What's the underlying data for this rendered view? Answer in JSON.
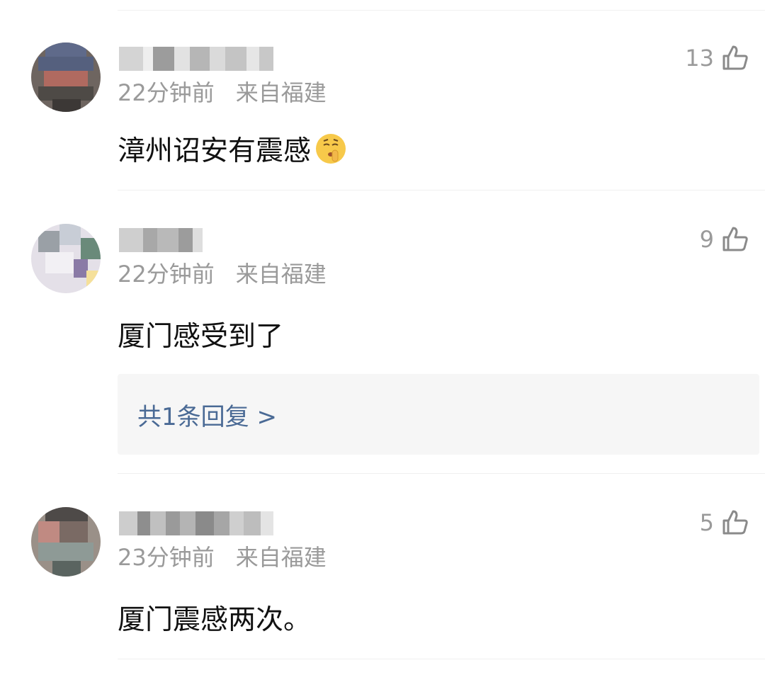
{
  "comments": [
    {
      "time": "22分钟前",
      "location": "来自福建",
      "likes": "13",
      "text": "漳州诏安有震感",
      "emoji_icon": "shushing-face-emoji"
    },
    {
      "time": "22分钟前",
      "location": "来自福建",
      "likes": "9",
      "text": "厦门感受到了",
      "reply_link": "共1条回复 >"
    },
    {
      "time": "23分钟前",
      "location": "来自福建",
      "likes": "5",
      "text": "厦门震感两次。"
    }
  ],
  "colors": {
    "meta_text": "#9a9a9a",
    "body_text": "#111111",
    "reply_link": "#4a6a95",
    "reply_bg": "#f6f6f6"
  },
  "icons": [
    "thumbs-up-icon",
    "avatar-blurred",
    "username-blurred"
  ]
}
